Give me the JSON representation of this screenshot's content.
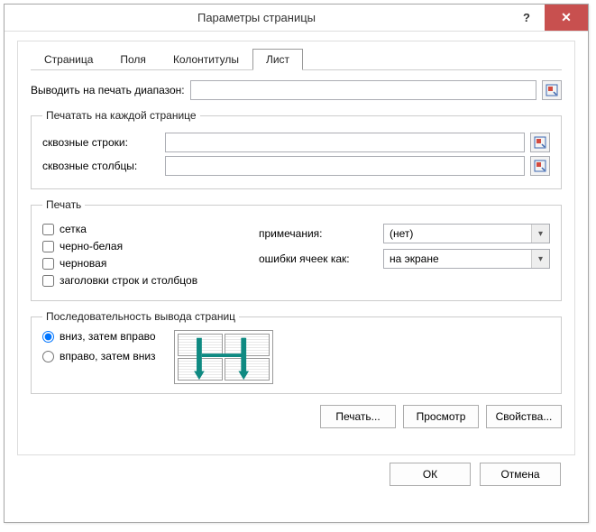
{
  "window": {
    "title": "Параметры страницы",
    "help_symbol": "?",
    "close_symbol": "✕"
  },
  "tabs": {
    "page": "Страница",
    "fields": "Поля",
    "headers": "Колонтитулы",
    "sheet": "Лист"
  },
  "sheet": {
    "print_range_label": "Выводить на печать диапазон:",
    "print_range_value": "",
    "repeat_group": "Печатать на каждой странице",
    "rows_label": "сквозные строки:",
    "rows_value": "",
    "cols_label": "сквозные столбцы:",
    "cols_value": "",
    "print_group": "Печать",
    "checks": {
      "grid": "сетка",
      "bw": "черно-белая",
      "draft": "черновая",
      "headings": "заголовки строк и столбцов"
    },
    "notes_label": "примечания:",
    "notes_value": "(нет)",
    "errors_label": "ошибки ячеек как:",
    "errors_value": "на экране",
    "order_group": "Последовательность вывода страниц",
    "order_down_right": "вниз, затем вправо",
    "order_right_down": "вправо, затем вниз"
  },
  "buttons": {
    "print": "Печать...",
    "preview": "Просмотр",
    "properties": "Свойства...",
    "ok": "ОК",
    "cancel": "Отмена"
  }
}
